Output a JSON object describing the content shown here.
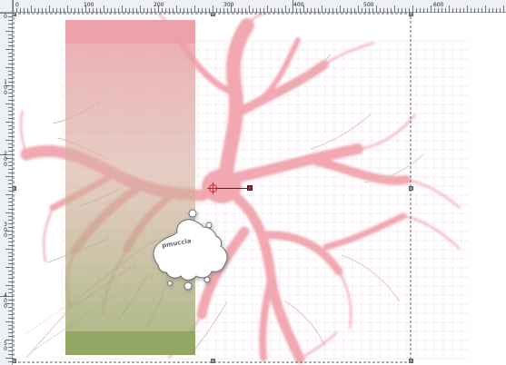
{
  "rulers": {
    "top_labels": [
      "0",
      "100",
      "200",
      "300",
      "400",
      "500",
      "600"
    ],
    "left_labels": [
      "0",
      "1 0 0",
      "2 0 0",
      "3 0 0",
      "4 0 0",
      "5 0"
    ]
  },
  "canvas": {
    "logo_text": "pmuccia"
  },
  "colors": {
    "ruler_bg": "#eef0f4",
    "branch_pink": "#f5a7b0",
    "branch_green": "#a8b37f",
    "grid_line": "#f1dcef",
    "overlay_top": "#eba0a7",
    "overlay_bottom": "#8ea45e"
  }
}
